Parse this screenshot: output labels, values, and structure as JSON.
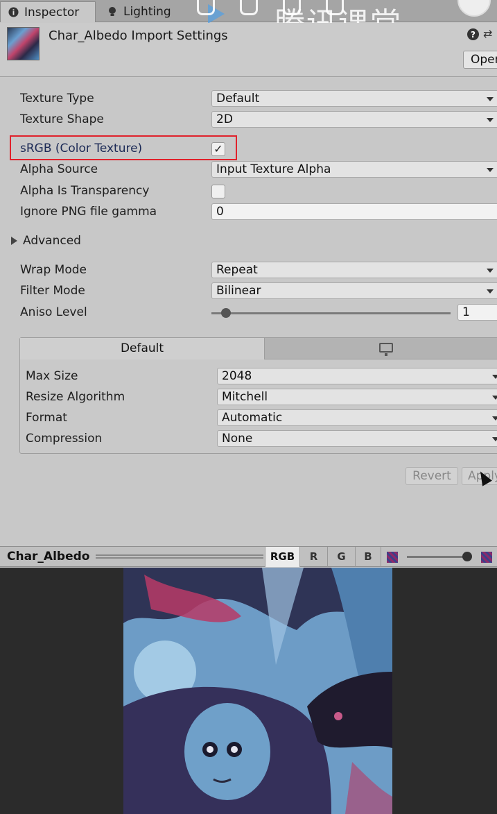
{
  "tabs": [
    {
      "label": "Inspector",
      "icon": "info-icon"
    },
    {
      "label": "Lighting",
      "icon": "lightbulb-icon"
    }
  ],
  "watermark": "腾讯课堂",
  "header": {
    "title": "Char_Albedo Import Settings",
    "open_label": "Open"
  },
  "properties": {
    "texture_type": {
      "label": "Texture Type",
      "value": "Default"
    },
    "texture_shape": {
      "label": "Texture Shape",
      "value": "2D"
    },
    "srgb": {
      "label": "sRGB (Color Texture)",
      "checked": "✓"
    },
    "alpha_source": {
      "label": "Alpha Source",
      "value": "Input Texture Alpha"
    },
    "alpha_transparency": {
      "label": "Alpha Is Transparency",
      "checked": ""
    },
    "ignore_png_gamma": {
      "label": "Ignore PNG file gamma",
      "value": "0"
    },
    "advanced": {
      "label": "Advanced"
    },
    "wrap_mode": {
      "label": "Wrap Mode",
      "value": "Repeat"
    },
    "filter_mode": {
      "label": "Filter Mode",
      "value": "Bilinear"
    },
    "aniso_level": {
      "label": "Aniso Level",
      "value": "1",
      "slider_fraction": 0.06
    }
  },
  "platform": {
    "tabs": {
      "default": "Default",
      "pc": "monitor-icon"
    },
    "max_size": {
      "label": "Max Size",
      "value": "2048"
    },
    "resize_algorithm": {
      "label": "Resize Algorithm",
      "value": "Mitchell"
    },
    "format": {
      "label": "Format",
      "value": "Automatic"
    },
    "compression": {
      "label": "Compression",
      "value": "None"
    }
  },
  "buttons": {
    "revert": "Revert",
    "apply": "Apply"
  },
  "preview": {
    "name": "Char_Albedo",
    "channels": [
      "RGB",
      "R",
      "G",
      "B"
    ],
    "active_channel": "RGB",
    "mip_fraction": 0.95
  },
  "colors": {
    "highlight": "#e0222c",
    "art_blue": "#6d9cc6",
    "art_pink": "#c0446b",
    "art_dark": "#2b2a48"
  }
}
